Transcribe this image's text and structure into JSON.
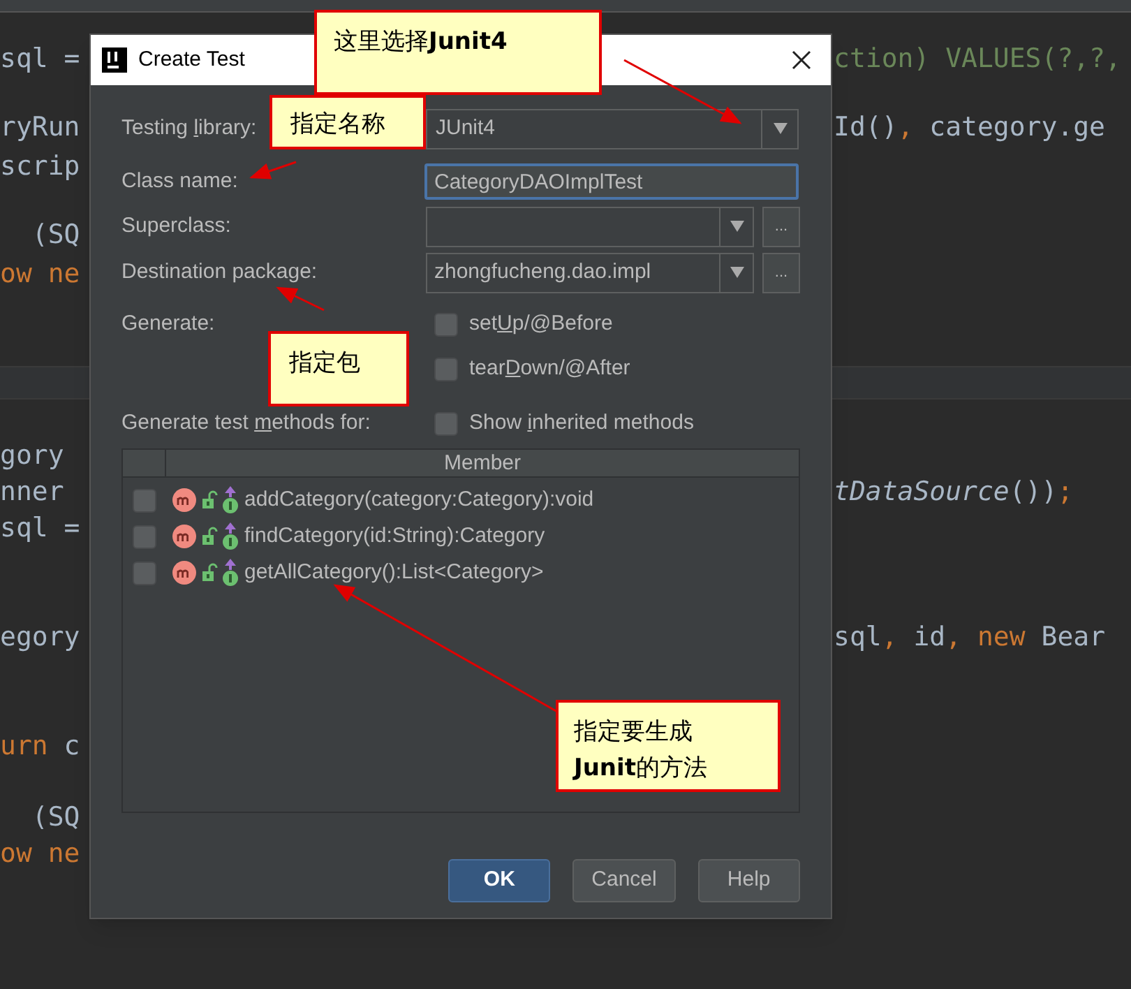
{
  "editor": {
    "left_lines": [
      [
        {
          "text": "sql =",
          "kind": "plain"
        }
      ],
      [
        {
          "text": "ryRun",
          "kind": "plain"
        }
      ],
      [
        {
          "text": "scrip",
          "kind": "plain"
        }
      ],
      [
        {
          "text": "  (SQ",
          "kind": "plain"
        }
      ],
      [
        {
          "text": "ow ne",
          "kind": "keyword"
        }
      ],
      [
        {
          "text": "gory",
          "kind": "plain"
        }
      ],
      [
        {
          "text": "nner",
          "kind": "plain"
        }
      ],
      [
        {
          "text": "sql =",
          "kind": "plain"
        }
      ],
      [
        {
          "text": "egory",
          "kind": "plain"
        }
      ],
      [
        {
          "text": "urn",
          "kind": "keyword"
        },
        {
          "text": " c",
          "kind": "plain"
        }
      ],
      [
        {
          "text": "  (SQ",
          "kind": "plain"
        }
      ],
      [
        {
          "text": "ow ne",
          "kind": "keyword"
        }
      ]
    ],
    "right_lines": [
      [
        {
          "text": "ction) VALUES(?,?,",
          "kind": "string"
        }
      ],
      [
        {
          "text": "Id()",
          "kind": "plain"
        },
        {
          "text": ",",
          "kind": "keyword"
        },
        {
          "text": " category.ge",
          "kind": "plain"
        }
      ],
      [
        {
          "text": "tDataSource",
          "kind": "italic"
        },
        {
          "text": "())",
          "kind": "plain"
        },
        {
          "text": ";",
          "kind": "keyword"
        }
      ],
      [
        {
          "text": "sql",
          "kind": "plain"
        },
        {
          "text": ",",
          "kind": "keyword"
        },
        {
          "text": " id",
          "kind": "plain"
        },
        {
          "text": ", new",
          "kind": "keyword"
        },
        {
          "text": " Bear",
          "kind": "plain"
        }
      ]
    ]
  },
  "dialog": {
    "title": "Create Test",
    "testing_library": {
      "label": [
        "Testing ",
        "l",
        "ibrary:"
      ],
      "value": "JUnit4"
    },
    "class_name": {
      "label": "Class name:",
      "value": "CategoryDAOImplTest"
    },
    "superclass": {
      "label": "Superclass:",
      "browse": "..."
    },
    "destination_package": {
      "label": "Destination package:",
      "value": "zhongfucheng.dao.impl",
      "browse": "..."
    },
    "generate": {
      "label": "Generate:",
      "options": [
        {
          "label": [
            "set",
            "U",
            "p/@Before"
          ],
          "checked": false
        },
        {
          "label": [
            "tear",
            "D",
            "own/@After"
          ],
          "checked": false
        }
      ]
    },
    "methods_for": {
      "label": [
        "Generate test ",
        "m",
        "ethods for:"
      ],
      "show_inherited": {
        "label": [
          "Show ",
          "i",
          "nherited methods"
        ],
        "checked": false
      }
    },
    "table": {
      "columns": [
        "Member"
      ],
      "rows": [
        {
          "member": "addCategory(category:Category):void",
          "checked": false
        },
        {
          "member": "findCategory(id:String):Category",
          "checked": false
        },
        {
          "member": "getAllCategory():List<Category>",
          "checked": false
        }
      ]
    },
    "buttons": [
      {
        "label": "OK",
        "kind": "primary"
      },
      {
        "label": "Cancel",
        "kind": "normal"
      },
      {
        "label": "Help",
        "kind": "normal"
      }
    ]
  },
  "annotations": [
    {
      "text": "这里选择**Junit4**"
    },
    {
      "text": "指定名称"
    },
    {
      "text": "指定包"
    },
    {
      "text": "指定要生成\n**Junit**的方法"
    }
  ]
}
